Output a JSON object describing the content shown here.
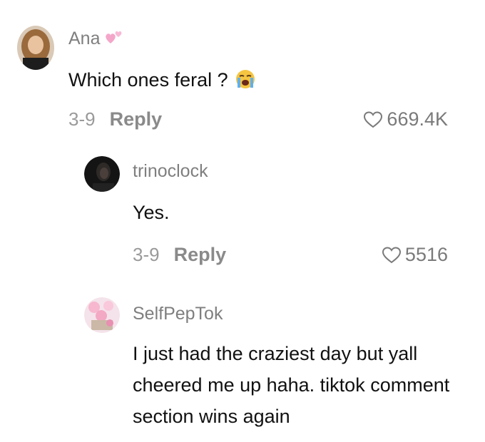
{
  "comments": [
    {
      "username": "Ana",
      "text": "Which ones feral ?",
      "date": "3-9",
      "reply_label": "Reply",
      "likes": "669.4K"
    },
    {
      "username": "trinoclock",
      "text": "Yes.",
      "date": "3-9",
      "reply_label": "Reply",
      "likes": "5516"
    },
    {
      "username": "SelfPepTok",
      "text": "I just had the craziest day but yall cheered me up haha. tiktok comment section wins again"
    }
  ],
  "colors": {
    "username": "#7f7f7f",
    "text": "#111111",
    "meta": "#8a8a8a"
  }
}
